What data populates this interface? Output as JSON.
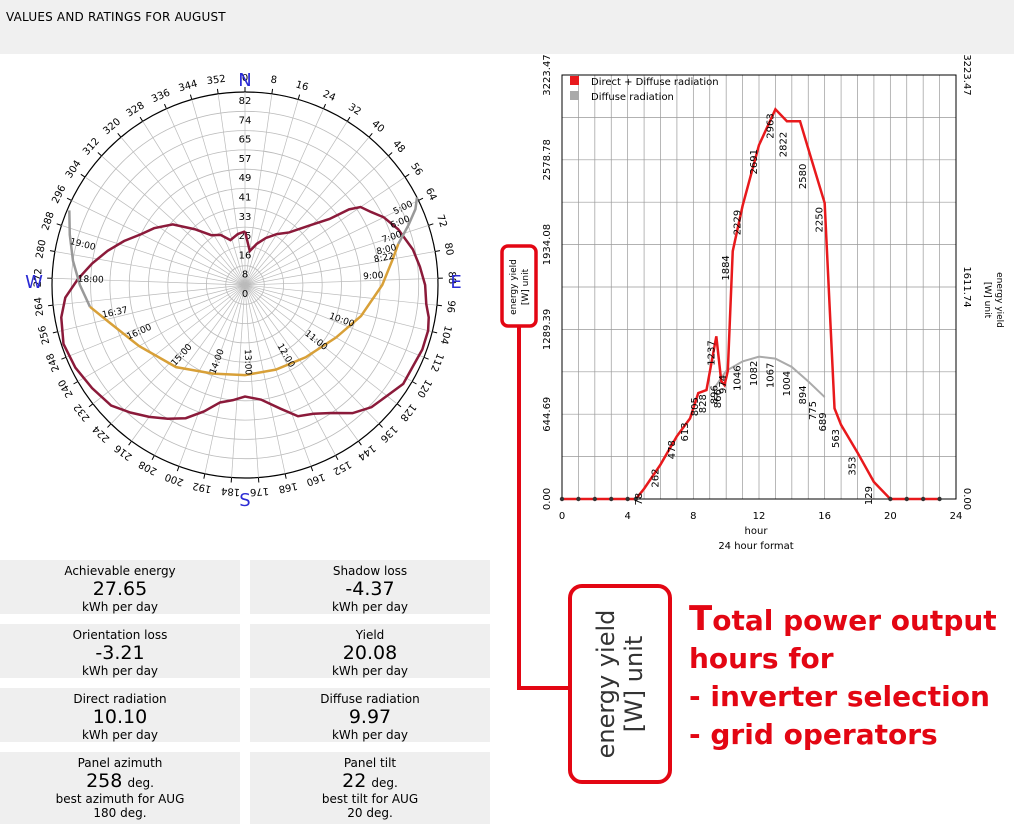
{
  "header": {
    "title": "VALUES AND RATINGS FOR AUGUST"
  },
  "polar": {
    "compass": {
      "N": "N",
      "E": "E",
      "S": "S",
      "W": "W"
    },
    "azimuth_labels": [
      "0",
      "8",
      "16",
      "24",
      "32",
      "40",
      "48",
      "56",
      "64",
      "72",
      "80",
      "88",
      "96",
      "104",
      "112",
      "120",
      "128",
      "136",
      "144",
      "152",
      "160",
      "168",
      "176",
      "184",
      "192",
      "200",
      "208",
      "216",
      "224",
      "232",
      "240",
      "248",
      "256",
      "264",
      "272",
      "280",
      "288",
      "296",
      "304",
      "312",
      "320",
      "328",
      "336",
      "344",
      "352"
    ],
    "elevation_labels": [
      "82",
      "74",
      "65",
      "57",
      "49",
      "41",
      "33",
      "25",
      "16",
      "8",
      "0"
    ],
    "sun_path": {
      "hours": [
        "5:00",
        "6:00",
        "7:00",
        "8:00",
        "8:22",
        "9:00",
        "10:00",
        "11:00",
        "12:00",
        "13:00",
        "14:00",
        "15:00",
        "16:00",
        "16:37",
        "18:00",
        "19:00"
      ],
      "colors": {
        "before": "#999999",
        "after": "#999999",
        "sun": "#d8a038"
      }
    },
    "horizon_color": "#8b1a3a"
  },
  "chart_data": {
    "type": "line",
    "x_label": "hour",
    "x_sublabel": "24 hour format",
    "y_label": "energy yield [W] unit",
    "y_right_label": "energy yield [W] unit",
    "x_ticks": [
      "0",
      "4",
      "8",
      "12",
      "16",
      "20",
      "24"
    ],
    "y_ticks": [
      "0.00",
      "644.69",
      "1289.39",
      "1934.08",
      "2578.78",
      "3223.47"
    ],
    "y_right_ticks": [
      "0.00",
      "1611.74",
      "3223.47"
    ],
    "xlim": [
      0,
      24
    ],
    "ylim": [
      0,
      3223.47
    ],
    "legend": [
      "Direct + Diffuse radiation",
      "Diffuse radiation"
    ],
    "series": [
      {
        "name": "Direct + Diffuse radiation",
        "color": "#e8191c",
        "x": [
          0,
          1,
          2,
          3,
          4,
          4.5,
          5,
          6,
          7,
          7.8,
          8.3,
          8.8,
          9.4,
          9.7,
          9.9,
          10.1,
          10.4,
          11,
          12,
          13,
          13.7,
          14.5,
          15.2,
          16,
          16.6,
          17,
          17.5,
          18,
          19,
          20,
          21,
          22,
          23
        ],
        "y": [
          0,
          0,
          0,
          0,
          0,
          0,
          78,
          262,
          478,
          613,
          805,
          828,
          1237,
          896,
          866,
          974,
          1884,
          2229,
          2691,
          2963,
          2872,
          2872,
          2580,
          2250,
          689,
          563,
          458,
          353,
          129,
          0,
          0,
          0,
          0
        ],
        "labels": [
          "78",
          "262",
          "478",
          "613",
          "805",
          "828",
          "1237",
          "896",
          "866",
          "974",
          "1884",
          "2229",
          "2691",
          "2963",
          "2822",
          "2580",
          "2250",
          "689",
          "563",
          "353",
          "129"
        ]
      },
      {
        "name": "Diffuse radiation",
        "color": "#aaaaaa",
        "x": [
          9.2,
          10,
          11,
          12,
          13,
          14,
          15,
          16
        ],
        "y": [
          828,
          974,
          1046,
          1082,
          1067,
          1004,
          894,
          775
        ],
        "labels": [
          "1046",
          "1082",
          "1067",
          "1004",
          "894",
          "775"
        ]
      }
    ]
  },
  "stats": [
    {
      "label": "Achievable energy",
      "value": "27.65",
      "unit": "kWh per day"
    },
    {
      "label": "Shadow loss",
      "value": "-4.37",
      "unit": "kWh per day"
    },
    {
      "label": "Orientation loss",
      "value": "-3.21",
      "unit": "kWh per day"
    },
    {
      "label": "Yield",
      "value": "20.08",
      "unit": "kWh per day"
    },
    {
      "label": "Direct radiation",
      "value": "10.10",
      "unit": "kWh per day"
    },
    {
      "label": "Diffuse radiation",
      "value": "9.97",
      "unit": "kWh per day"
    }
  ],
  "panel": {
    "azimuth": {
      "label": "Panel azimuth",
      "value": "258",
      "unit": "deg.",
      "best_label": "best azimuth for AUG",
      "best_value": "180",
      "best_unit": "deg."
    },
    "tilt": {
      "label": "Panel tilt",
      "value": "22",
      "unit": "deg.",
      "best_label": "best tilt for AUG",
      "best_value": "20",
      "best_unit": "deg."
    }
  },
  "zoom": {
    "line1": "energy yield",
    "line2": "[W] unit"
  },
  "annotation": {
    "first_letter": "T",
    "line1_rest": "otal power output",
    "line2": "hours for",
    "line3": "- inverter selection",
    "line4": "- grid operators",
    "color": "#e30613"
  }
}
